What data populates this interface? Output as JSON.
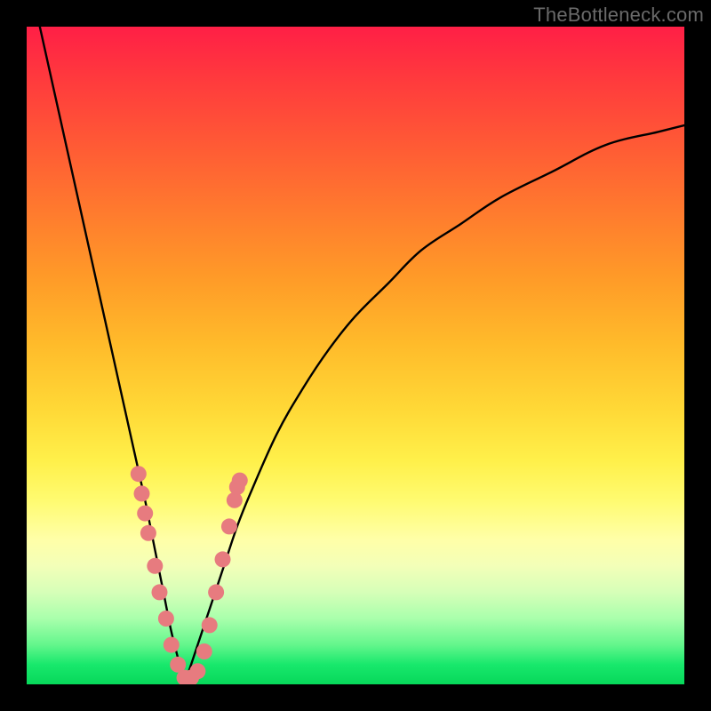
{
  "watermark": {
    "text": "TheBottleneck.com"
  },
  "colors": {
    "background": "#000000",
    "curve": "#000000",
    "marker_fill": "#e77b7f",
    "marker_stroke": "#d9676b"
  },
  "chart_data": {
    "type": "line",
    "title": "",
    "xlabel": "",
    "ylabel": "",
    "xlim": [
      0,
      100
    ],
    "ylim": [
      0,
      100
    ],
    "grid": false,
    "legend": false,
    "note": "Values are approximate percentages read from the V-shaped bottleneck curve; x is horizontal position, y is curve height (0 at bottom).",
    "series": [
      {
        "name": "left-branch",
        "x": [
          2,
          4,
          6,
          8,
          10,
          12,
          14,
          16,
          18,
          19,
          20,
          21,
          22,
          23,
          24
        ],
        "values": [
          100,
          91,
          82,
          73,
          64,
          55,
          46,
          37,
          28,
          23,
          18,
          13,
          8,
          4,
          0
        ]
      },
      {
        "name": "right-branch",
        "x": [
          24,
          26,
          28,
          30,
          32,
          34,
          38,
          42,
          46,
          50,
          55,
          60,
          66,
          72,
          80,
          88,
          96,
          100
        ],
        "values": [
          0,
          6,
          12,
          18,
          24,
          29,
          38,
          45,
          51,
          56,
          61,
          66,
          70,
          74,
          78,
          82,
          84,
          85
        ]
      }
    ],
    "markers": {
      "name": "highlight-cluster",
      "points": [
        {
          "x": 17.0,
          "y": 32
        },
        {
          "x": 17.5,
          "y": 29
        },
        {
          "x": 18.0,
          "y": 26
        },
        {
          "x": 18.5,
          "y": 23
        },
        {
          "x": 19.5,
          "y": 18
        },
        {
          "x": 20.2,
          "y": 14
        },
        {
          "x": 21.2,
          "y": 10
        },
        {
          "x": 22.0,
          "y": 6
        },
        {
          "x": 23.0,
          "y": 3
        },
        {
          "x": 24.0,
          "y": 1
        },
        {
          "x": 25.0,
          "y": 1
        },
        {
          "x": 26.0,
          "y": 2
        },
        {
          "x": 27.0,
          "y": 5
        },
        {
          "x": 27.8,
          "y": 9
        },
        {
          "x": 28.8,
          "y": 14
        },
        {
          "x": 29.8,
          "y": 19
        },
        {
          "x": 30.8,
          "y": 24
        },
        {
          "x": 31.6,
          "y": 28
        },
        {
          "x": 32.0,
          "y": 30
        },
        {
          "x": 32.4,
          "y": 31
        }
      ]
    }
  }
}
